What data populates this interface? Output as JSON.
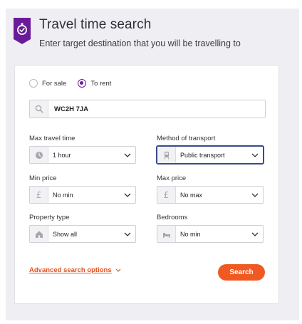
{
  "header": {
    "title": "Travel time search",
    "subtitle": "Enter target destination that you will be travelling to"
  },
  "listing_type": {
    "options": [
      {
        "label": "For sale",
        "selected": false
      },
      {
        "label": "To rent",
        "selected": true
      }
    ]
  },
  "destination": {
    "value": "WC2H 7JA",
    "icon": "search-icon"
  },
  "fields": {
    "max_travel_time": {
      "label": "Max travel time",
      "value": "1 hour",
      "icon": "clock-icon"
    },
    "method_of_transport": {
      "label": "Method of transport",
      "value": "Public transport",
      "icon": "train-icon"
    },
    "min_price": {
      "label": "Min price",
      "value": "No min",
      "icon": "£"
    },
    "max_price": {
      "label": "Max price",
      "value": "No max",
      "icon": "£"
    },
    "property_type": {
      "label": "Property type",
      "value": "Show all",
      "icon": "house-icon"
    },
    "bedrooms": {
      "label": "Bedrooms",
      "value": "No min",
      "icon": "bed-icon"
    }
  },
  "actions": {
    "advanced_label": "Advanced search options",
    "search_label": "Search"
  },
  "colors": {
    "brand_purple": "#6a1b9a",
    "accent_orange": "#f05a22",
    "panel_bg": "#efeff3"
  }
}
